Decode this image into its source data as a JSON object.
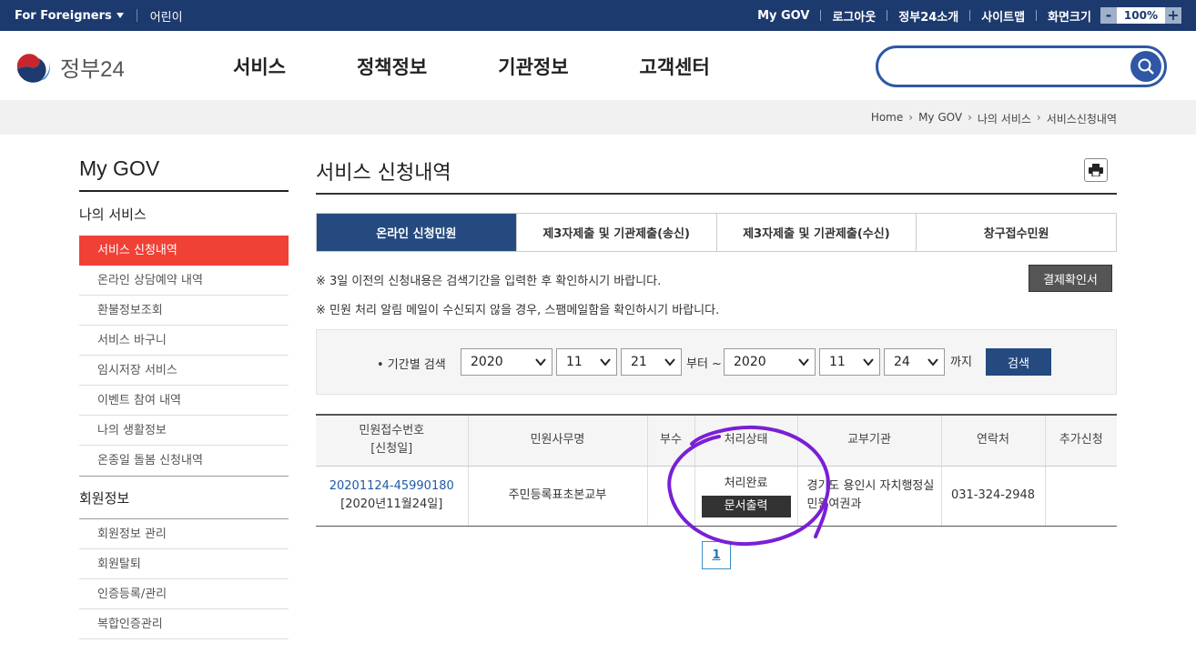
{
  "topbar": {
    "foreigners": "For Foreigners",
    "kids": "어린이",
    "links": [
      "My GOV",
      "로그아웃",
      "정부24소개",
      "사이트맵"
    ],
    "zoom_label": "화면크기",
    "zoom_value": "100%",
    "zoom_minus": "-",
    "zoom_plus": "+"
  },
  "header": {
    "logo_text": "정부24",
    "nav": [
      "서비스",
      "정책정보",
      "기관정보",
      "고객센터"
    ],
    "search_placeholder": ""
  },
  "breadcrumb": [
    "Home",
    "My GOV",
    "나의 서비스",
    "서비스신청내역"
  ],
  "sidebar": {
    "title": "My GOV",
    "group1": "나의 서비스",
    "items": [
      "서비스 신청내역",
      "온라인 상담예약 내역",
      "환불정보조회",
      "서비스 바구니",
      "임시저장 서비스",
      "이벤트 참여 내역",
      "나의 생활정보",
      "온종일 돌봄 신청내역"
    ],
    "group2": "회원정보",
    "items2": [
      "회원정보 관리",
      "회원탈퇴",
      "인증등록/관리",
      "복합인증관리"
    ]
  },
  "main": {
    "title": "서비스 신청내역",
    "tabs": [
      "온라인 신청민원",
      "제3자제출 및 기관제출(송신)",
      "제3자제출 및 기관제출(수신)",
      "창구접수민원"
    ],
    "notice1": "※ 3일 이전의 신청내용은 검색기간을 입력한 후 확인하시기 바랍니다.",
    "notice2": "※ 민원 처리 알림 메일이 수신되지 않을 경우, 스팸메일함을 확인하시기 바랍니다.",
    "payment_button": "결제확인서",
    "search": {
      "label": "• 기간별 검색",
      "from_year": "2020",
      "from_month": "11",
      "from_day": "21",
      "from_text": "부터 ~",
      "to_year": "2020",
      "to_month": "11",
      "to_day": "24",
      "to_text": "까지",
      "button": "검색"
    },
    "table": {
      "headers": [
        "민원접수번호",
        "[신청일]",
        "민원사무명",
        "부수",
        "처리상태",
        "교부기관",
        "연락처",
        "추가신청"
      ],
      "row": {
        "number": "20201124-45990180",
        "date": "[2020년11월24일]",
        "name": "주민등록표초본교부",
        "copies": "",
        "status": "처리완료",
        "print_button": "문서출력",
        "agency_line1": "경기도 용인시 자치행정실",
        "agency_line2": "민원여권과",
        "contact": "031-324-2948",
        "extra": ""
      }
    },
    "pager": "1"
  },
  "colors": {
    "topbar": "#1c3a6e",
    "active_tab": "#244a80",
    "sidebar_active": "#f04137",
    "annotation": "#7a1fd6"
  }
}
